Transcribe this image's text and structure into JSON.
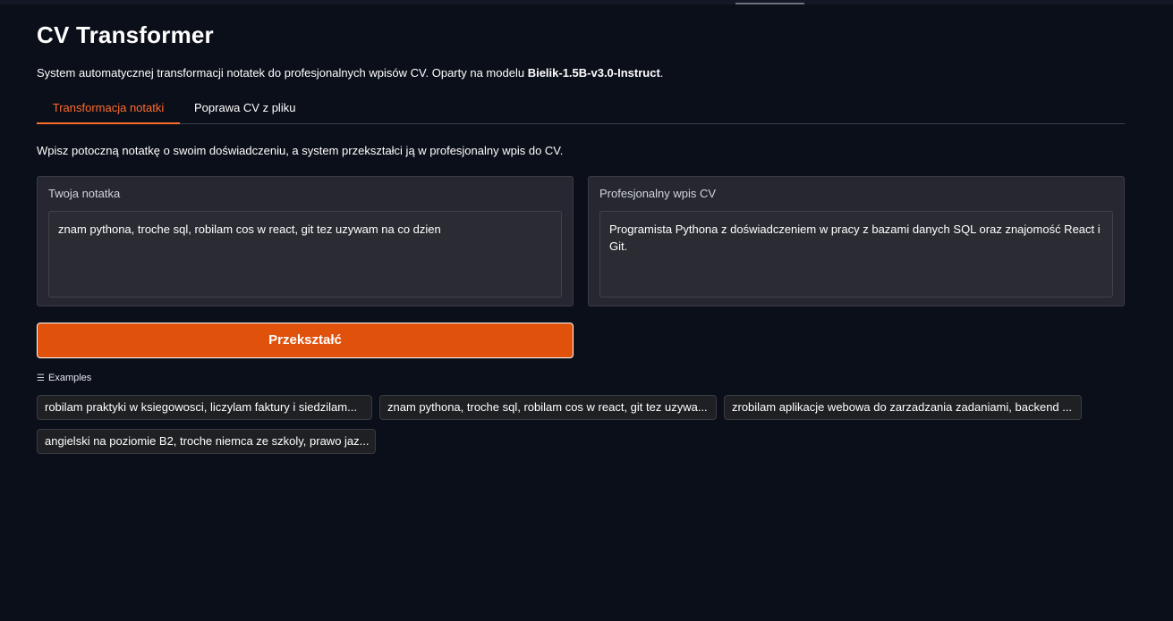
{
  "app": {
    "title": "CV Transformer",
    "subtitle_prefix": "System automatycznej transformacji notatek do profesjonalnych wpisów CV. Oparty na modelu ",
    "model_name": "Bielik-1.5B-v3.0-Instruct",
    "subtitle_suffix": "."
  },
  "tabs": [
    {
      "label": "Transformacja notatki",
      "active": true
    },
    {
      "label": "Poprawa CV z pliku",
      "active": false
    }
  ],
  "description": "Wpisz potoczną notatkę o swoim doświadczeniu, a system przekształci ją w profesjonalny wpis do CV.",
  "input_panel": {
    "label": "Twoja notatka",
    "value": "znam pythona, troche sql, robilam cos w react, git tez uzywam na co dzien"
  },
  "output_panel": {
    "label": "Profesjonalny wpis CV",
    "value": "Programista Pythona z doświadczeniem w pracy z bazami danych SQL oraz znajomość React i Git."
  },
  "submit_button": {
    "label": "Przekształć"
  },
  "examples": {
    "label": "Examples",
    "items": [
      "robilam praktyki w ksiegowosci, liczylam faktury i siedzilam...",
      "znam pythona, troche sql, robilam cos w react, git tez uzywa...",
      "zrobilam aplikacje webowa do zarzadzania zadaniami, backend ...",
      "angielski na poziomie B2, troche niemca ze szkoly, prawo jaz..."
    ]
  },
  "colors": {
    "background": "#0b0f19",
    "accent": "#ff6b2b",
    "button": "#e0510b",
    "panel": "#262730"
  }
}
